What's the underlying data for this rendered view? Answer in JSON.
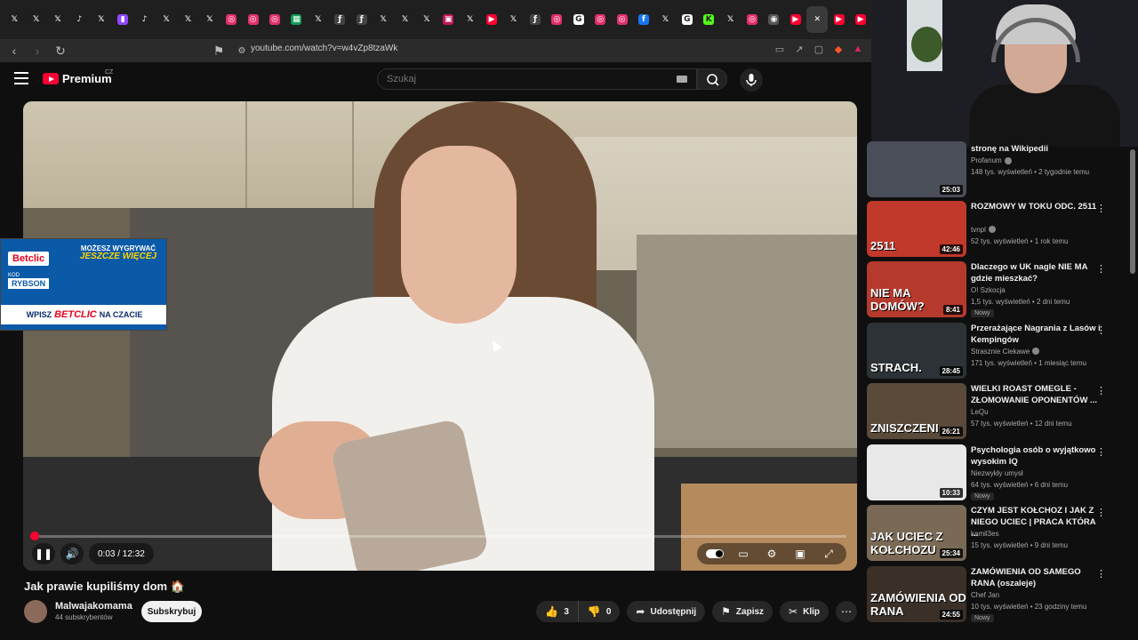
{
  "browser": {
    "tabs": [
      {
        "icon": "x-icon",
        "glyph": "𝕏",
        "color": "#1f1f1f"
      },
      {
        "icon": "x-icon",
        "glyph": "𝕏",
        "color": "#1f1f1f"
      },
      {
        "icon": "x-icon",
        "glyph": "𝕏",
        "color": "#1f1f1f"
      },
      {
        "icon": "tiktok-icon",
        "glyph": "♪",
        "color": "#1f1f1f"
      },
      {
        "icon": "x-icon",
        "glyph": "𝕏",
        "color": "#1f1f1f"
      },
      {
        "icon": "twitch-icon",
        "glyph": "▮",
        "color": "#9146ff"
      },
      {
        "icon": "tiktok-icon",
        "glyph": "♪",
        "color": "#1f1f1f"
      },
      {
        "icon": "x-icon",
        "glyph": "𝕏",
        "color": "#1f1f1f"
      },
      {
        "icon": "x-icon",
        "glyph": "𝕏",
        "color": "#1f1f1f"
      },
      {
        "icon": "x-icon",
        "glyph": "𝕏",
        "color": "#1f1f1f"
      },
      {
        "icon": "instagram-icon",
        "glyph": "◎",
        "color": "#e1306c"
      },
      {
        "icon": "instagram-icon",
        "glyph": "◎",
        "color": "#e1306c"
      },
      {
        "icon": "instagram-icon",
        "glyph": "◎",
        "color": "#e1306c"
      },
      {
        "icon": "sheets-icon",
        "glyph": "▦",
        "color": "#0f9d58"
      },
      {
        "icon": "x-icon",
        "glyph": "𝕏",
        "color": "#1f1f1f"
      },
      {
        "icon": "script-icon",
        "glyph": "ƒ",
        "color": "#444444"
      },
      {
        "icon": "script-icon",
        "glyph": "ƒ",
        "color": "#444444"
      },
      {
        "icon": "x-icon",
        "glyph": "𝕏",
        "color": "#1f1f1f"
      },
      {
        "icon": "x-icon",
        "glyph": "𝕏",
        "color": "#1f1f1f"
      },
      {
        "icon": "x-icon",
        "glyph": "𝕏",
        "color": "#1f1f1f"
      },
      {
        "icon": "image-icon",
        "glyph": "▣",
        "color": "#c2185b"
      },
      {
        "icon": "x-icon",
        "glyph": "𝕏",
        "color": "#1f1f1f"
      },
      {
        "icon": "youtube-icon",
        "glyph": "▶",
        "color": "#ff0033"
      },
      {
        "icon": "x-icon",
        "glyph": "𝕏",
        "color": "#1f1f1f"
      },
      {
        "icon": "script-icon",
        "glyph": "ƒ",
        "color": "#444444"
      },
      {
        "icon": "instagram-icon",
        "glyph": "◎",
        "color": "#e1306c"
      },
      {
        "icon": "google-icon",
        "glyph": "G",
        "color": "#ffffff"
      },
      {
        "icon": "instagram-icon",
        "glyph": "◎",
        "color": "#e1306c"
      },
      {
        "icon": "instagram-icon",
        "glyph": "◎",
        "color": "#e1306c"
      },
      {
        "icon": "facebook-icon",
        "glyph": "f",
        "color": "#1877f2"
      },
      {
        "icon": "x-icon",
        "glyph": "𝕏",
        "color": "#1f1f1f"
      },
      {
        "icon": "google-icon",
        "glyph": "G",
        "color": "#ffffff"
      },
      {
        "icon": "kick-icon",
        "glyph": "K",
        "color": "#53fc18"
      },
      {
        "icon": "x-icon",
        "glyph": "𝕏",
        "color": "#1f1f1f"
      },
      {
        "icon": "instagram-icon",
        "glyph": "◎",
        "color": "#e1306c"
      },
      {
        "icon": "gamepad-icon",
        "glyph": "◉",
        "color": "#555555"
      },
      {
        "icon": "youtube-icon",
        "glyph": "▶",
        "color": "#ff0033"
      },
      {
        "icon": "close-icon",
        "glyph": "✕",
        "color": "#3a3a3a",
        "active": true
      },
      {
        "icon": "youtube-icon",
        "glyph": "▶",
        "color": "#ff0033"
      },
      {
        "icon": "youtube-icon",
        "glyph": "▶",
        "color": "#ff0033"
      }
    ],
    "url": "youtube.com/watch?v=w4vZp8tzaWk"
  },
  "youtube": {
    "logo_text": "Premium",
    "logo_region": "CZ",
    "search_placeholder": "Szukaj",
    "brand_color": "#ff0033"
  },
  "video": {
    "time_display": "0:03 / 12:32",
    "progress_fraction": 0.004,
    "ad": {
      "brand": "Betclic",
      "headline_top": "MOŻESZ WYGRYWAĆ",
      "headline_main": "JESZCZE WIĘCEJ",
      "code_label": "KOD",
      "code_value": "RYBSON",
      "footer_pre": "WPISZ",
      "footer_brand": "BETCLIC",
      "footer_post": "NA CZACIE"
    }
  },
  "info": {
    "title": "Jak prawie kupiliśmy dom 🏠",
    "channel": "Malwajakomama",
    "subscribers": "44 subskrybentów",
    "subscribe_label": "Subskrybuj",
    "likes": "3",
    "dislikes": "0",
    "share_label": "Udostępnij",
    "save_label": "Zapisz",
    "clip_label": "Klip"
  },
  "recommendations": [
    {
      "title": "stronę na Wikipedii",
      "channel": "Profanum",
      "verified": true,
      "meta": "148 tys. wyświetleń • 2 tygodnie temu",
      "duration": "25:03",
      "thumb_color": "#4a4e58",
      "thumb_text": "",
      "badge": ""
    },
    {
      "title": "ROZMOWY W TOKU ODC. 2511",
      "channel": "tvnpl",
      "verified": true,
      "meta": "52 tys. wyświetleń • 1 rok temu",
      "duration": "42:46",
      "thumb_color": "#c0392b",
      "thumb_text": "2511",
      "badge": ""
    },
    {
      "title": "Dlaczego w UK nagle NIE MA gdzie mieszkać?",
      "channel": "O! Szkocja",
      "verified": false,
      "meta": "1,5 tys. wyświetleń • 2 dni temu",
      "duration": "8:41",
      "thumb_color": "#b53a2d",
      "thumb_text": "NIE MA DOMÓW?",
      "badge": "Nowy"
    },
    {
      "title": "Przerażające Nagrania z Lasów i Kempingów",
      "channel": "Strasznie Ciekawe",
      "verified": true,
      "meta": "171 tys. wyświetleń • 1 miesiąc temu",
      "duration": "28:45",
      "thumb_color": "#2c3236",
      "thumb_text": "STRACH.",
      "badge": ""
    },
    {
      "title": "WIELKI ROAST OMEGLE - ZŁOMOWANIE OPONENTÓW ...",
      "channel": "LeQu",
      "verified": false,
      "meta": "57 tys. wyświetleń • 12 dni temu",
      "duration": "26:21",
      "thumb_color": "#5a4a3a",
      "thumb_text": "ZNISZCZENI",
      "badge": ""
    },
    {
      "title": "Psychologia osób o wyjątkowo wysokim IQ",
      "channel": "Niezwykły umysł",
      "verified": false,
      "meta": "64 tys. wyświetleń • 6 dni temu",
      "duration": "10:33",
      "thumb_color": "#e8e8e8",
      "thumb_text": "",
      "badge": "Nowy"
    },
    {
      "title": "CZYM JEST KOŁCHOZ I JAK Z NIEGO UCIEC | PRACA KTÓRA ...",
      "channel": "kamil3es",
      "verified": false,
      "meta": "15 tys. wyświetleń • 9 dni temu",
      "duration": "25:34",
      "thumb_color": "#7a6a55",
      "thumb_text": "JAK UCIEC Z KOŁCHOZU",
      "badge": ""
    },
    {
      "title": "ZAMÓWIENIA OD SAMEGO RANA (oszaleje)",
      "channel": "Chef Jan",
      "verified": false,
      "meta": "10 tys. wyświetleń • 23 godziny temu",
      "duration": "24:55",
      "thumb_color": "#3a3028",
      "thumb_text": "ZAMÓWIENIA OD RANA",
      "badge": "Nowy"
    }
  ]
}
